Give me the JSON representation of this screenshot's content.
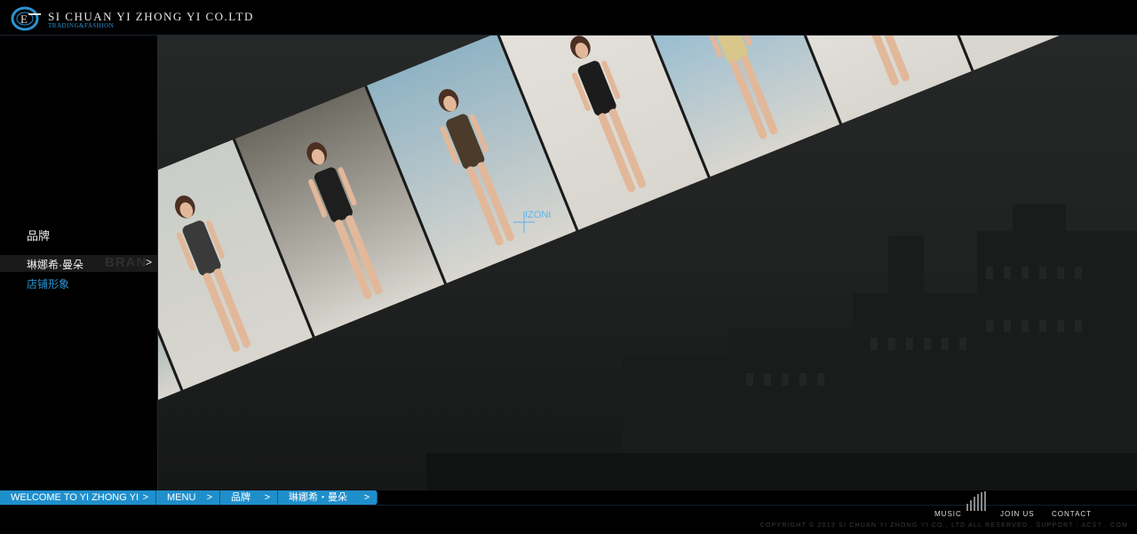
{
  "header": {
    "company": "SI CHUAN YI ZHONG YI CO.LTD",
    "tagline": "TRADING&FASHION"
  },
  "sidebar": {
    "title": "品牌",
    "active_item": {
      "label": "琳娜希·曼朵",
      "ghost": "BRAN",
      "arrow": ">"
    },
    "item": {
      "label": "店铺形象"
    }
  },
  "stage": {
    "watermark": "IZONI",
    "panels": [
      {
        "bg": "#3a6f86"
      },
      {
        "bg": "#c9cdc8"
      },
      {
        "bg": "#6d6a62"
      },
      {
        "bg": "#8fb3c4"
      },
      {
        "bg": "#e4e0da"
      },
      {
        "bg": "#7fb3d0"
      },
      {
        "bg": "#ecebe7"
      },
      {
        "bg": "#d2d7d6"
      },
      {
        "bg": "#b7b1a8"
      }
    ]
  },
  "breadcrumb": [
    {
      "label": "WELCOME TO YI ZHONG YI",
      "sep": ">"
    },
    {
      "label": "MENU",
      "sep": ">"
    },
    {
      "label": "品牌",
      "sep": ">"
    },
    {
      "label": "琳娜希・曼朵",
      "sep": ">"
    }
  ],
  "footer": {
    "music": "MUSIC",
    "join": "JOIN US",
    "contact": "CONTACT",
    "copyright": "COPYRIGHT © 2013 SI CHUAN YI ZHONG YI CO., LTD ALL RESERVED . SUPPORT : ACS7 . COM"
  },
  "colors": {
    "accent": "#1f8fcc",
    "link": "#2a93d3",
    "bg": "#000000"
  }
}
